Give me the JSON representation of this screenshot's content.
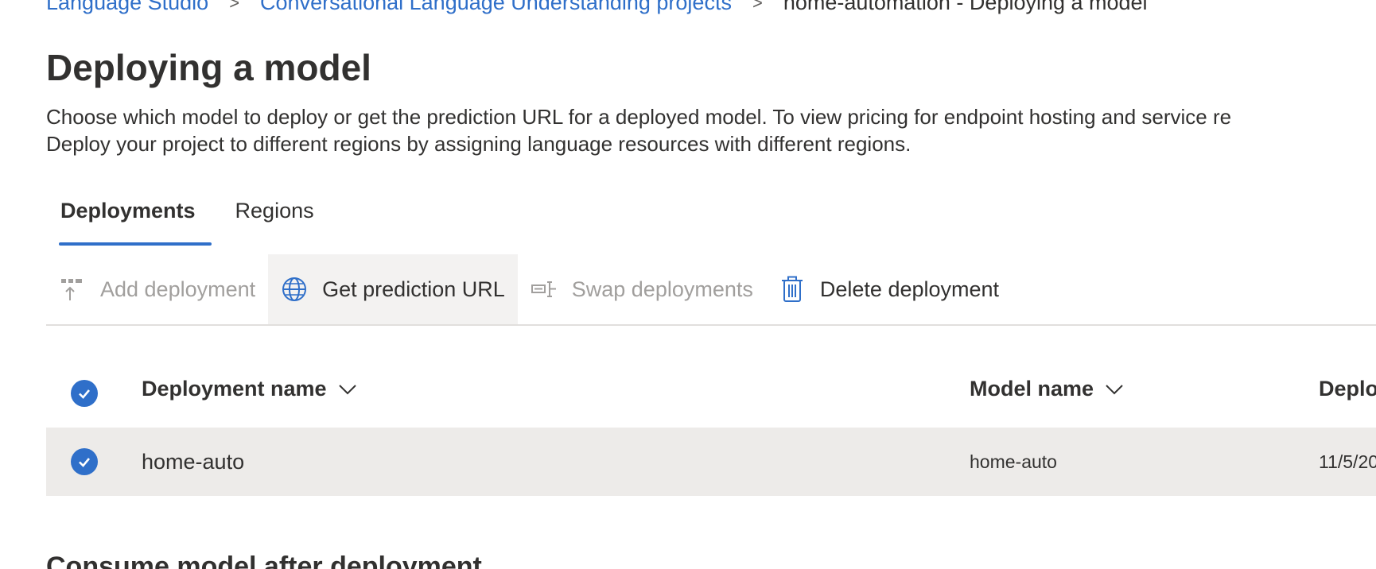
{
  "breadcrumb": {
    "items": [
      "Language Studio",
      "Conversational Language Understanding projects"
    ],
    "separator": ">",
    "current": "home-automation - Deploying a model"
  },
  "page": {
    "title": "Deploying a model",
    "description_line1": "Choose which model to deploy or get the prediction URL for a deployed model. To view pricing for endpoint hosting and service re",
    "description_line2": "Deploy your project to different regions by assigning language resources with different regions."
  },
  "tabs": [
    {
      "label": "Deployments",
      "active": true
    },
    {
      "label": "Regions",
      "active": false
    }
  ],
  "toolbar": {
    "add_deployment": {
      "label": "Add deployment",
      "icon": "add-deployment-icon",
      "enabled": false
    },
    "get_prediction_url": {
      "label": "Get prediction URL",
      "icon": "globe-icon",
      "enabled": true
    },
    "swap_deployments": {
      "label": "Swap deployments",
      "icon": "swap-icon",
      "enabled": false
    },
    "delete_deployment": {
      "label": "Delete deployment",
      "icon": "trash-icon",
      "enabled": true
    }
  },
  "table": {
    "columns": [
      "Deployment name",
      "Model name",
      "Deplo"
    ],
    "rows": [
      {
        "deployment_name": "home-auto",
        "model_name": "home-auto",
        "deployed_on": "11/5/20",
        "selected": true
      }
    ],
    "all_selected": true
  },
  "section": {
    "consume_title": "Consume model after deployment"
  },
  "colors": {
    "accent": "#2f6fc9",
    "text": "#323130",
    "disabled": "#a19f9d",
    "selected_row": "#edebe9"
  }
}
